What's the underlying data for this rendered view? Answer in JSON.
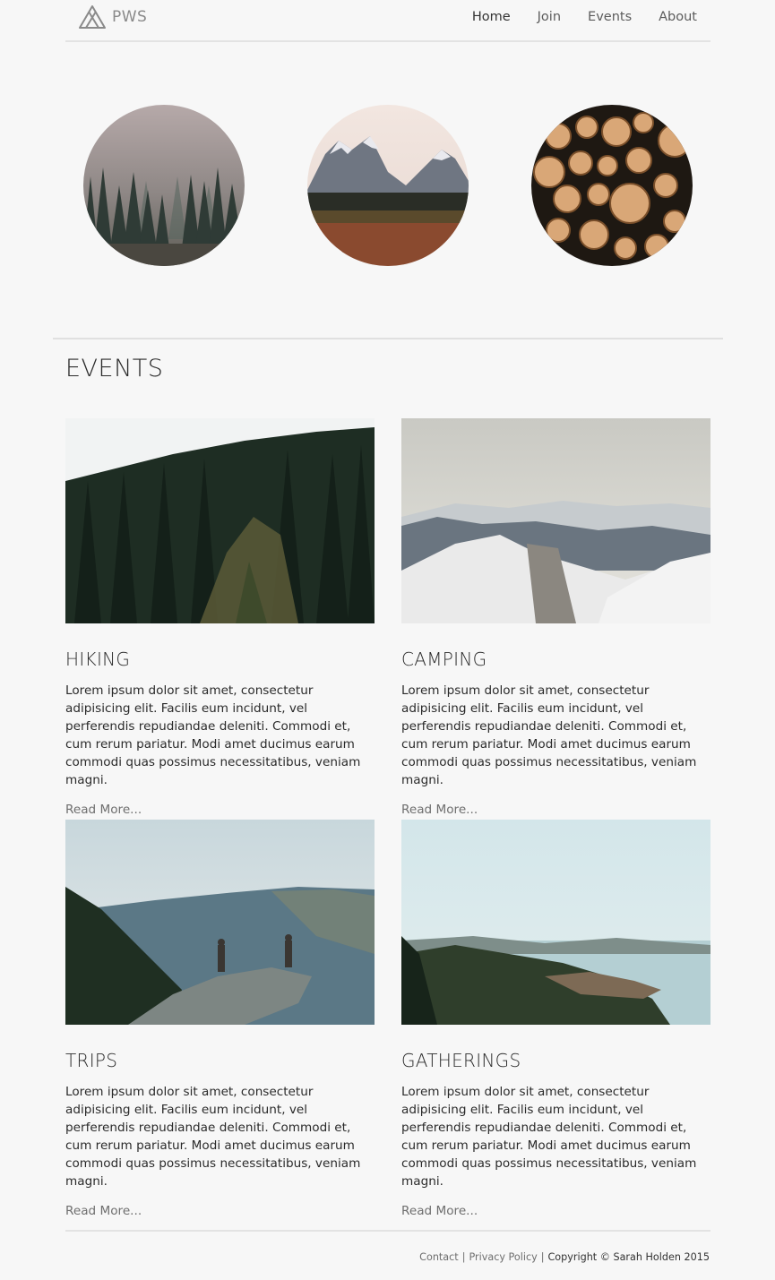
{
  "header": {
    "logo_text": "PWS",
    "nav": [
      "Home",
      "Join",
      "Events",
      "About"
    ],
    "active": "Home"
  },
  "hero_images": [
    "forest-trees-in-mist",
    "mountain-peaks-valley",
    "stacked-cut-logs"
  ],
  "events": {
    "title": "EVENTS",
    "cards": [
      {
        "title": "HIKING",
        "image": "pine-forest-hillside",
        "text": "Lorem ipsum dolor sit amet, consectetur adipisicing elit. Facilis eum incidunt, vel perferendis repudiandae deleniti. Commodi et, cum rerum pariatur. Modi amet ducimus earum commodi quas possimus necessitatibus, veniam magni.",
        "link": "Read More..."
      },
      {
        "title": "CAMPING",
        "image": "snowy-mountains",
        "text": "Lorem ipsum dolor sit amet, consectetur adipisicing elit. Facilis eum incidunt, vel perferendis repudiandae deleniti. Commodi et, cum rerum pariatur. Modi amet ducimus earum commodi quas possimus necessitatibus, veniam magni.",
        "link": "Read More..."
      },
      {
        "title": "TRIPS",
        "image": "hikers-on-rock-overlook",
        "text": "Lorem ipsum dolor sit amet, consectetur adipisicing elit. Facilis eum incidunt, vel perferendis repudiandae deleniti. Commodi et, cum rerum pariatur. Modi amet ducimus earum commodi quas possimus necessitatibus, veniam magni.",
        "link": "Read More..."
      },
      {
        "title": "GATHERINGS",
        "image": "coastal-town-bay",
        "text": "Lorem ipsum dolor sit amet, consectetur adipisicing elit. Facilis eum incidunt, vel perferendis repudiandae deleniti. Commodi et, cum rerum pariatur. Modi amet ducimus earum commodi quas possimus necessitatibus, veniam magni.",
        "link": "Read More..."
      }
    ]
  },
  "footer": {
    "contact": "Contact",
    "privacy": "Privacy Policy",
    "separator": "|",
    "copyright": "Copyright © Sarah Holden 2015"
  }
}
